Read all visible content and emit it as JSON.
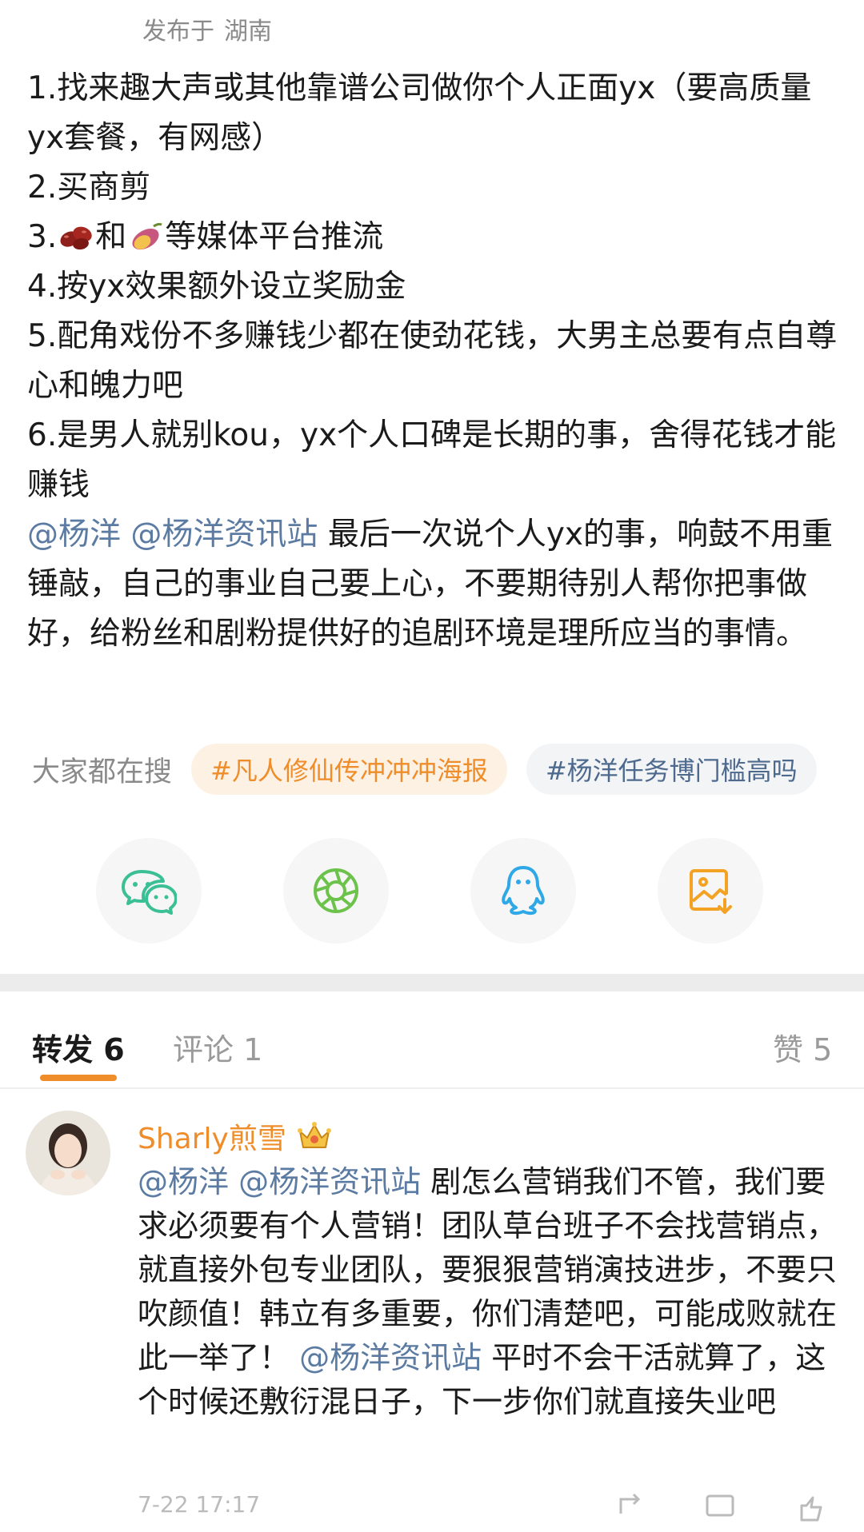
{
  "post_meta": {
    "published_prefix": "发布于",
    "location": "湖南"
  },
  "post": {
    "line1": "1.找来趣大声或其他靠谱公司做你个人正面yx（要高质量yx套餐，有网感）",
    "line2": "2.买商剪",
    "line3_prefix": "3.",
    "line3_and": "和",
    "line3_suffix": "等媒体平台推流",
    "line4": "4.按yx效果额外设立奖励金",
    "line5": "5.配角戏份不多赚钱少都在使劲花钱，大男主总要有点自尊心和魄力吧",
    "line6": "6.是男人就别kou，yx个人口碑是长期的事，舍得花钱才能赚钱",
    "mention1": "@杨洋",
    "mention2": "@杨洋资讯站",
    "closing": " 最后一次说个人yx的事，响鼓不用重锤敲，自己的事业自己要上心，不要期待别人帮你把事做好，给粉丝和剧粉提供好的追剧环境是理所应当的事情。"
  },
  "search": {
    "label": "大家都在搜",
    "chips": [
      "#凡人修仙传冲冲冲海报",
      "#杨洋任务博门槛高吗"
    ]
  },
  "share": {
    "icons": [
      "wechat-icon",
      "moments-icon",
      "qq-icon",
      "save-image-icon"
    ]
  },
  "tabs": {
    "repost": "转发 6",
    "comment": "评论 1",
    "like": "赞 5"
  },
  "comment": {
    "author": "Sharly煎雪",
    "mention1": "@杨洋",
    "mention2": "@杨洋资讯站",
    "text1": "  剧怎么营销我们不管，我们要求必须要有个人营销！团队草台班子不会找营销点，就直接外包专业团队，要狠狠营销演技进步，不要只吹颜值！韩立有多重要，你们清楚吧，可能成败就在此一举了！",
    "mention3": "@杨洋资讯站",
    "text2": " 平时不会干活就算了，这个时候还敷衍混日子，下一步你们就直接失业吧",
    "time": "7-22 17:17"
  },
  "colors": {
    "accent": "#ef8d2b",
    "mention": "#5b7ba3",
    "wechat": "#3bbf94",
    "moments": "#6cc24a",
    "qq": "#2ea8e6",
    "save": "#f3a224"
  }
}
